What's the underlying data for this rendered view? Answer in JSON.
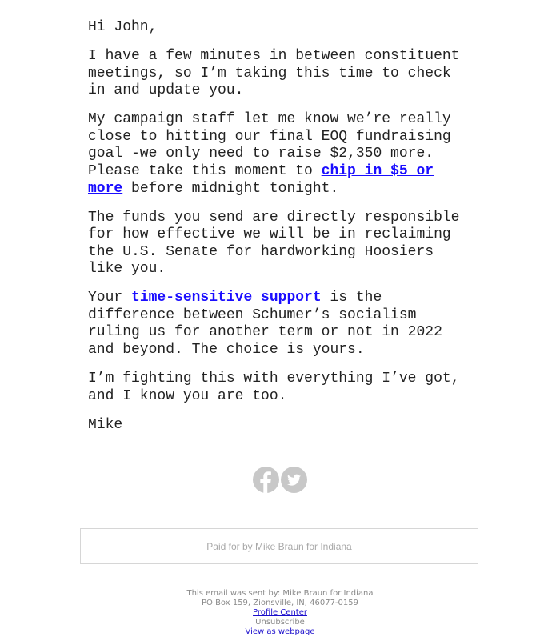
{
  "email": {
    "greeting": "Hi John,",
    "paragraphs": {
      "p1": "I have a few minutes in between constituent meetings, so I’m taking this time to check in and update you.",
      "p2_before": "My campaign staff let me know we’re really close to hitting our final EOQ fundraising goal -we only need to raise $2,350 more. Please take this moment to ",
      "p2_link": "chip in $5 or more",
      "p2_after": " before midnight tonight.",
      "p3": "The funds you send are directly responsible for how effective we will be in reclaiming the U.S. Senate for hardworking Hoosiers like you.",
      "p4_before": "Your ",
      "p4_link": "time-sensitive support",
      "p4_after": " is the difference between Schumer’s socialism ruling us for another term or not in 2022 and beyond. The choice is yours.",
      "p5": "I’m fighting this with everything I’ve got, and I know you are too."
    },
    "signature": "Mike"
  },
  "social": {
    "icons": [
      "facebook-icon",
      "twitter-icon"
    ],
    "color": "#c8c8c8"
  },
  "paid_for": "Paid for by Mike Braun for Indiana",
  "footer": {
    "sent_by": "This email was sent by: Mike Braun for Indiana",
    "address": "PO Box 159, Zionsville, IN, 46077-0159",
    "profile_center": "Profile Center",
    "unsubscribe": "Unsubscribe",
    "view_webpage": "View as webpage"
  },
  "colors": {
    "link": "#1a0dff",
    "text": "#222222",
    "muted": "#8a8a8a"
  }
}
